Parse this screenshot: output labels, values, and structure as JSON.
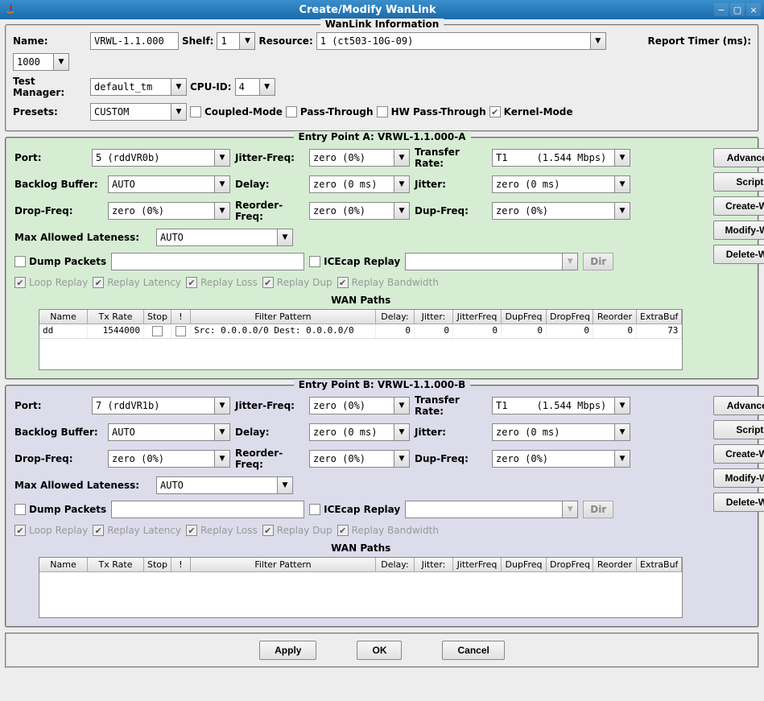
{
  "window": {
    "title": "Create/Modify WanLink"
  },
  "info": {
    "legend": "WanLink Information",
    "name_label": "Name:",
    "name_value": "VRWL-1.1.000",
    "shelf_label": "Shelf:",
    "shelf_value": "1",
    "resource_label": "Resource:",
    "resource_value": "1 (ct503-10G-09)",
    "report_label": "Report Timer (ms):",
    "report_value": "1000",
    "tm_label": "Test Manager:",
    "tm_value": "default_tm",
    "cpu_label": "CPU-ID:",
    "cpu_value": "4",
    "presets_label": "Presets:",
    "presets_value": "CUSTOM",
    "coupled": "Coupled-Mode",
    "pass": "Pass-Through",
    "hwpass": "HW Pass-Through",
    "kernel": "Kernel-Mode"
  },
  "epA": {
    "legend": "Entry Point A:  VRWL-1.1.000-A",
    "port_label": "Port:",
    "port_value": "5 (rddVR0b)",
    "jfreq_label": "Jitter-Freq:",
    "jfreq_value": "zero (0%)",
    "trate_label": "Transfer Rate:",
    "trate_value": "T1     (1.544 Mbps)",
    "backlog_label": "Backlog Buffer:",
    "backlog_value": "AUTO",
    "delay_label": "Delay:",
    "delay_value": "zero (0 ms)",
    "jitter_label": "Jitter:",
    "jitter_value": "zero (0 ms)",
    "dropfreq_label": "Drop-Freq:",
    "dropfreq_value": "zero (0%)",
    "refreq_label": "Reorder-Freq:",
    "refreq_value": "zero (0%)",
    "dupfreq_label": "Dup-Freq:",
    "dupfreq_value": "zero (0%)",
    "maxlate_label": "Max Allowed Lateness:",
    "maxlate_value": "AUTO",
    "dump": "Dump Packets",
    "ice": "ICEcap Replay",
    "dir": "Dir",
    "loop": "Loop Replay",
    "rlat": "Replay Latency",
    "rloss": "Replay Loss",
    "rdup": "Replay Dup",
    "rbw": "Replay Bandwidth",
    "wanpaths": "WAN Paths",
    "btns": {
      "adv": "Advanced",
      "script": "Script",
      "cwp": "Create-WP",
      "mwp": "Modify-WP",
      "dwp": "Delete-WP"
    },
    "cols": [
      "Name",
      "Tx Rate",
      "Stop",
      "!",
      "Filter Pattern",
      "Delay:",
      "Jitter:",
      "JitterFreq",
      "DupFreq",
      "DropFreq",
      "Reorder",
      "ExtraBuf"
    ],
    "row": {
      "name": "dd",
      "txrate": "1544000",
      "filter": "Src: 0.0.0.0/0  Dest: 0.0.0.0/0",
      "delay": "0",
      "jitter": "0",
      "jfreq": "0",
      "dupfreq": "0",
      "dropfreq": "0",
      "reorder": "0",
      "extrabuf": "73"
    }
  },
  "epB": {
    "legend": "Entry Point B:  VRWL-1.1.000-B",
    "port_label": "Port:",
    "port_value": "7 (rddVR1b)",
    "jfreq_label": "Jitter-Freq:",
    "jfreq_value": "zero (0%)",
    "trate_label": "Transfer Rate:",
    "trate_value": "T1     (1.544 Mbps)",
    "backlog_label": "Backlog Buffer:",
    "backlog_value": "AUTO",
    "delay_label": "Delay:",
    "delay_value": "zero (0 ms)",
    "jitter_label": "Jitter:",
    "jitter_value": "zero (0 ms)",
    "dropfreq_label": "Drop-Freq:",
    "dropfreq_value": "zero (0%)",
    "refreq_label": "Reorder-Freq:",
    "refreq_value": "zero (0%)",
    "dupfreq_label": "Dup-Freq:",
    "dupfreq_value": "zero (0%)",
    "maxlate_label": "Max Allowed Lateness:",
    "maxlate_value": "AUTO",
    "dump": "Dump Packets",
    "ice": "ICEcap Replay",
    "dir": "Dir",
    "loop": "Loop Replay",
    "rlat": "Replay Latency",
    "rloss": "Replay Loss",
    "rdup": "Replay Dup",
    "rbw": "Replay Bandwidth",
    "wanpaths": "WAN Paths",
    "btns": {
      "adv": "Advanced",
      "script": "Script",
      "cwp": "Create-WP",
      "mwp": "Modify-WP",
      "dwp": "Delete-WP"
    },
    "cols": [
      "Name",
      "Tx Rate",
      "Stop",
      "!",
      "Filter Pattern",
      "Delay:",
      "Jitter:",
      "JitterFreq",
      "DupFreq",
      "DropFreq",
      "Reorder",
      "ExtraBuf"
    ]
  },
  "footer": {
    "apply": "Apply",
    "ok": "OK",
    "cancel": "Cancel"
  }
}
